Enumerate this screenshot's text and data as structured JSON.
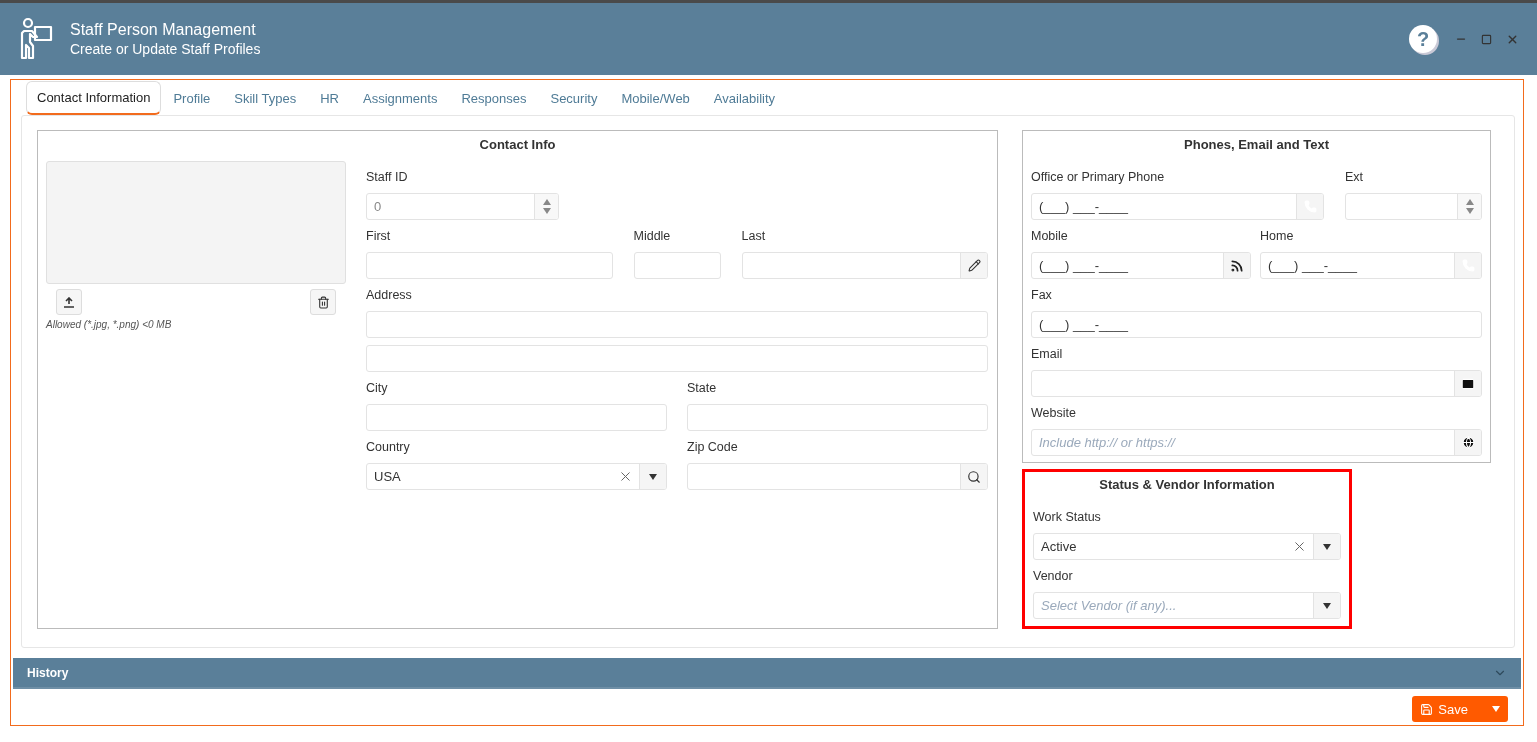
{
  "header": {
    "title": "Staff Person Management",
    "subtitle": "Create or Update Staff Profiles",
    "help_glyph": "?"
  },
  "tabs": [
    {
      "label": "Contact Information",
      "selected": true
    },
    {
      "label": "Profile",
      "selected": false
    },
    {
      "label": "Skill Types",
      "selected": false
    },
    {
      "label": "HR",
      "selected": false
    },
    {
      "label": "Assignments",
      "selected": false
    },
    {
      "label": "Responses",
      "selected": false
    },
    {
      "label": "Security",
      "selected": false
    },
    {
      "label": "Mobile/Web",
      "selected": false
    },
    {
      "label": "Availability",
      "selected": false
    }
  ],
  "contact_info": {
    "title": "Contact Info",
    "photo_note": "Allowed (*.jpg, *.png) <0 MB",
    "staff_id": {
      "label": "Staff ID",
      "value": "0",
      "disabled": true
    },
    "first": {
      "label": "First"
    },
    "middle": {
      "label": "Middle"
    },
    "last": {
      "label": "Last"
    },
    "address": {
      "label": "Address"
    },
    "city": {
      "label": "City"
    },
    "state": {
      "label": "State"
    },
    "country": {
      "label": "Country",
      "value": "USA"
    },
    "zip_code": {
      "label": "Zip Code"
    }
  },
  "phones": {
    "title": "Phones, Email and Text",
    "office_phone": {
      "label": "Office or Primary Phone",
      "value": "(___) ___-____"
    },
    "ext": {
      "label": "Ext"
    },
    "mobile": {
      "label": "Mobile",
      "value": "(___) ___-____"
    },
    "home": {
      "label": "Home",
      "value": "(___) ___-____"
    },
    "fax": {
      "label": "Fax",
      "value": "(___) ___-____"
    },
    "email": {
      "label": "Email"
    },
    "website": {
      "label": "Website",
      "placeholder": "Include http:// or https://"
    }
  },
  "status": {
    "title": "Status & Vendor Information",
    "work_status": {
      "label": "Work Status",
      "value": "Active"
    },
    "vendor": {
      "label": "Vendor",
      "placeholder": "Select Vendor (if any)..."
    }
  },
  "history": {
    "title": "History",
    "expanded": false
  },
  "save": {
    "label": "Save"
  }
}
